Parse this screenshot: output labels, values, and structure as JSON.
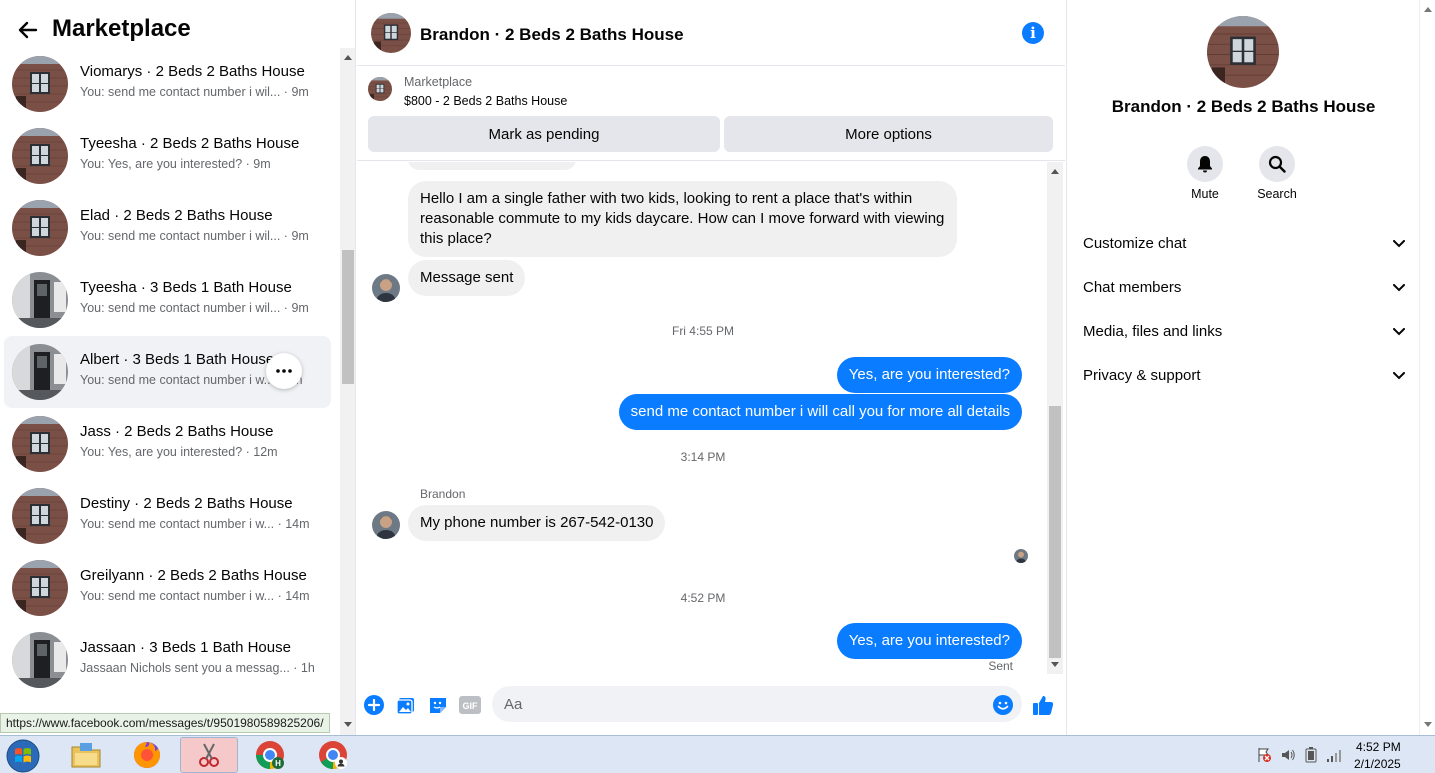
{
  "left": {
    "title": "Marketplace",
    "conversations": [
      {
        "name": "Viomarys · 2 Beds 2 Baths House",
        "snippet": "You: send me contact number i wil... · 9m",
        "thumb": "brick"
      },
      {
        "name": "Tyeesha · 2 Beds 2 Baths House",
        "snippet": "You: Yes, are you interested? · 9m",
        "thumb": "brick"
      },
      {
        "name": "Elad · 2 Beds 2 Baths House",
        "snippet": "You: send me contact number i wil... · 9m",
        "thumb": "brick"
      },
      {
        "name": "Tyeesha · 3 Beds 1 Bath House",
        "snippet": "You: send me contact number i wil... · 9m",
        "thumb": "gray"
      },
      {
        "name": "Albert · 3 Beds 1 Bath House",
        "snippet": "You: send me contact number i w... · 9m",
        "thumb": "gray"
      },
      {
        "name": "Jass · 2 Beds 2 Baths House",
        "snippet": "You: Yes, are you interested? · 12m",
        "thumb": "brick"
      },
      {
        "name": "Destiny · 2 Beds 2 Baths House",
        "snippet": "You: send me contact number i w... · 14m",
        "thumb": "brick"
      },
      {
        "name": "Greilyann · 2 Beds 2 Baths House",
        "snippet": "You: send me contact number i w... · 14m",
        "thumb": "brick"
      },
      {
        "name": "Jassaan · 3 Beds 1 Bath House",
        "snippet": "Jassaan Nichols sent you a messag... · 1h",
        "thumb": "gray"
      }
    ],
    "active_index": 4,
    "status_url": "https://www.facebook.com/messages/t/9501980589825206/"
  },
  "chat": {
    "title": "Brandon · 2 Beds 2 Baths House",
    "listing": {
      "label": "Marketplace",
      "price_title": "$800 - 2 Beds 2 Baths House",
      "mark_pending": "Mark as pending",
      "more_options": "More options"
    },
    "messages": {
      "m1": "Hello I am a single father with two kids, looking to rent a place that's within reasonable commute to my kids daycare. How can I move forward with viewing this place?",
      "m2": "Message sent",
      "ts1": "Fri 4:55 PM",
      "m3": "Yes, are you interested?",
      "m4": "send me contact number i will call you for more all details",
      "ts2": "3:14 PM",
      "sender": "Brandon",
      "m5": "My phone number is 267-542-0130",
      "ts3": "4:52 PM",
      "m6": "Yes, are you interested?",
      "sent_status": "Sent"
    },
    "composer": {
      "placeholder": "Aa"
    }
  },
  "right": {
    "title": "Brandon · 2 Beds 2 Baths House",
    "mute": "Mute",
    "search": "Search",
    "sections": [
      "Customize chat",
      "Chat members",
      "Media, files and links",
      "Privacy & support"
    ]
  },
  "taskbar": {
    "time": "4:52 PM",
    "date": "2/1/2025"
  },
  "colors": {
    "accent": "#0a7cff",
    "bubble_in": "#f0f0f0",
    "bubble_out": "#0a7cff"
  }
}
